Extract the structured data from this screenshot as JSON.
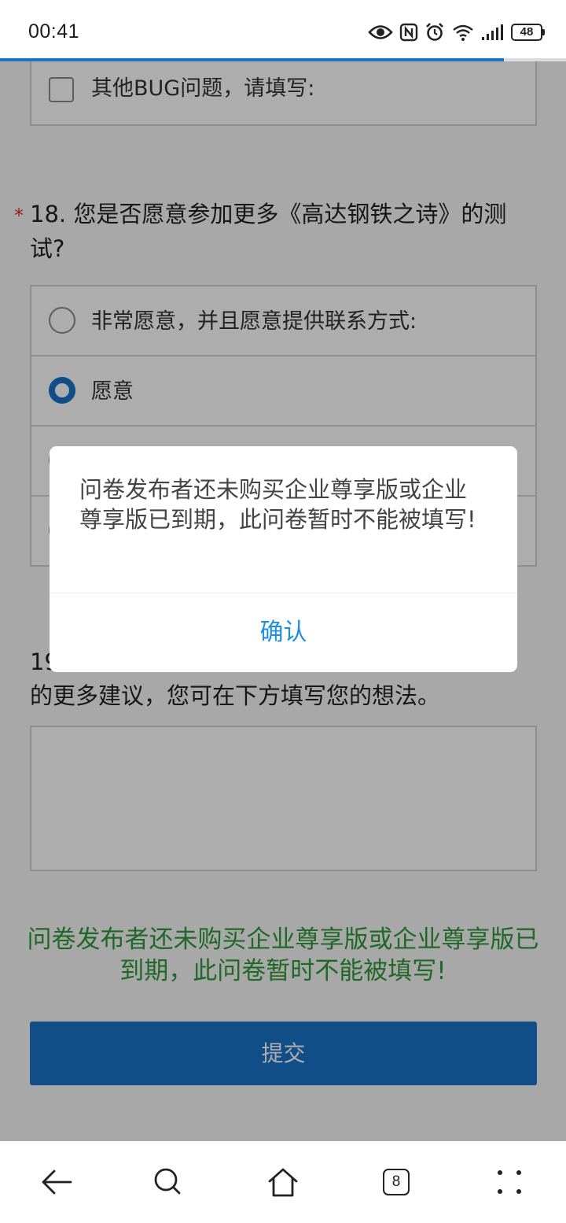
{
  "status_bar": {
    "time": "00:41",
    "battery": "48",
    "icons": [
      "eye-icon",
      "nfc-icon",
      "alarm-icon",
      "wifi-icon",
      "signal-icon",
      "battery-icon"
    ]
  },
  "page_progress": {
    "fraction": 0.89,
    "color": "#1a73c8"
  },
  "q17": {
    "options": [
      {
        "label": "其他BUG问题，请填写:",
        "type": "checkbox",
        "checked": false
      }
    ]
  },
  "q18": {
    "required_mark": "*",
    "title": "18. 您是否愿意参加更多《高达钢铁之诗》的测试?",
    "options": [
      {
        "label": "非常愿意，并且愿意提供联系方式:",
        "selected": false
      },
      {
        "label": "愿意",
        "selected": true
      },
      {
        "label": "",
        "selected": false
      },
      {
        "label": "",
        "selected": false
      }
    ]
  },
  "q19": {
    "visible_text": "19",
    "continued_text": "的更多建议，您可在下方填写您的想法。"
  },
  "notice": "问卷发布者还未购买企业尊享版或企业尊享版已到期，此问卷暂时不能被填写!",
  "submit_label": "提交",
  "dialog": {
    "message": "问卷发布者还未购买企业尊享版或企业尊享版已到期，此问卷暂时不能被填写!",
    "confirm_label": "确认"
  },
  "nav_bar": {
    "tab_count": "8",
    "items": [
      "back-icon",
      "search-icon",
      "home-icon",
      "tabs-icon",
      "more-icon"
    ]
  },
  "colors": {
    "accent": "#1a73c8",
    "dialog_button": "#1b8fe0",
    "notice": "#2e9a3a",
    "required": "#e0302c"
  }
}
